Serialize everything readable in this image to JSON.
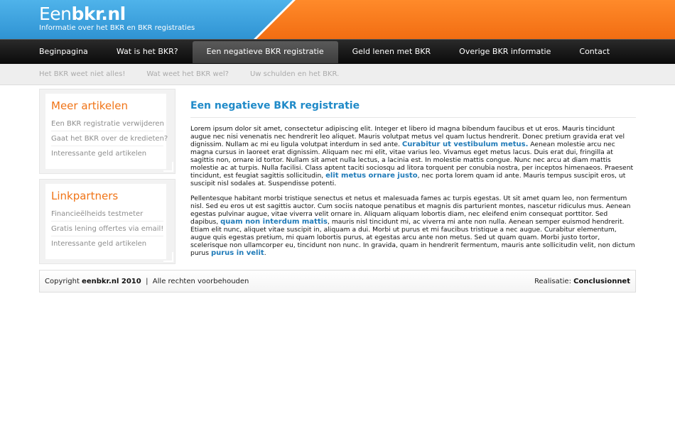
{
  "header": {
    "logo_light": "Een",
    "logo_bold": "bkr.nl",
    "tagline": "Informatie over het BKR en BKR registraties"
  },
  "nav": {
    "items": [
      {
        "label": "Beginpagina"
      },
      {
        "label": "Wat is het BKR?"
      },
      {
        "label": "Een negatieve BKR registratie"
      },
      {
        "label": "Geld lenen met BKR"
      },
      {
        "label": "Overige BKR informatie"
      },
      {
        "label": "Contact"
      }
    ],
    "active_index": 2
  },
  "subnav": {
    "items": [
      {
        "label": "Het BKR weet niet alles!"
      },
      {
        "label": "Wat weet het BKR wel?"
      },
      {
        "label": "Uw schulden en het BKR."
      }
    ]
  },
  "sidebar": {
    "boxes": [
      {
        "title": "Meer artikelen",
        "links": [
          {
            "label": "Een BKR registratie verwijderen"
          },
          {
            "label": "Gaat het BKR over de kredieten?"
          },
          {
            "label": "Interessante geld artikelen"
          }
        ]
      },
      {
        "title": "Linkpartners",
        "links": [
          {
            "label": "Financieëlheids testmeter"
          },
          {
            "label": "Gratis lening offertes via email!"
          },
          {
            "label": "Interessante geld artikelen"
          }
        ]
      }
    ]
  },
  "content": {
    "title": "Een negatieve BKR registratie",
    "p1_a": "Lorem ipsum dolor sit amet, consectetur adipiscing elit. Integer et libero id magna bibendum faucibus et ut eros. Mauris tincidunt augue nec nisi venenatis nec hendrerit leo aliquet. Mauris volutpat metus vel quam luctus hendrerit. Donec pretium gravida erat vel dignissim. Nullam ac mi eu ligula volutpat interdum in sed ante. ",
    "p1_link1": "Curabitur ut vestibulum metus.",
    "p1_b": " Aenean molestie arcu nec magna cursus in laoreet erat dignissim. Aliquam nec mi elit, vitae varius leo. Vivamus eget metus lacus. Duis erat dui, fringilla at sagittis non, ornare id tortor. Nullam sit amet nulla lectus, a lacinia est. In molestie mattis congue. Nunc nec arcu at diam mattis molestie ac at turpis. Nulla facilisi. Class aptent taciti sociosqu ad litora torquent per conubia nostra, per inceptos himenaeos. Praesent tincidunt, est feugiat sagittis sollicitudin, ",
    "p1_link2": "elit metus ornare justo",
    "p1_c": ", nec porta lorem quam id ante. Mauris tempus suscipit eros, ut suscipit nisl sodales at. Suspendisse potenti.",
    "p2_a": "Pellentesque habitant morbi tristique senectus et netus et malesuada fames ac turpis egestas. Ut sit amet quam leo, non fermentum nisl. Sed eu eros ut est sagittis auctor. Cum sociis natoque penatibus et magnis dis parturient montes, nascetur ridiculus mus. Aenean egestas pulvinar augue, vitae viverra velit ornare in. Aliquam aliquam lobortis diam, nec eleifend enim consequat porttitor. Sed dapibus, ",
    "p2_link1": "quam non interdum mattis",
    "p2_b": ", mauris nisl tincidunt mi, ac viverra mi ante non nulla. Aenean semper euismod hendrerit. Etiam elit nunc, aliquet vitae suscipit in, aliquam a dui. Morbi ut purus et mi faucibus tristique a nec augue. Curabitur elementum, augue quis egestas pretium, mi quam lobortis purus, at egestas arcu ante non metus. Sed ut quam quam. Morbi justo tortor, scelerisque non ullamcorper eu, tincidunt non nunc. In gravida, quam in hendrerit fermentum, mauris ante sollicitudin velit, non dictum purus ",
    "p2_link2": "purus in velit",
    "p2_c": "."
  },
  "footer": {
    "copyright_prefix": "Copyright ",
    "copyright_site": "eenbkr.nl 2010",
    "copyright_suffix": "  |  Alle rechten voorbehouden",
    "credit_prefix": "Realisatie: ",
    "credit_name": "Conclusionnet"
  },
  "colors": {
    "header_orange": "#f26d12",
    "header_blue": "#2f93d3",
    "accent_orange": "#f07417",
    "link_blue": "#1f7ab8",
    "title_blue": "#1f8ac8"
  }
}
